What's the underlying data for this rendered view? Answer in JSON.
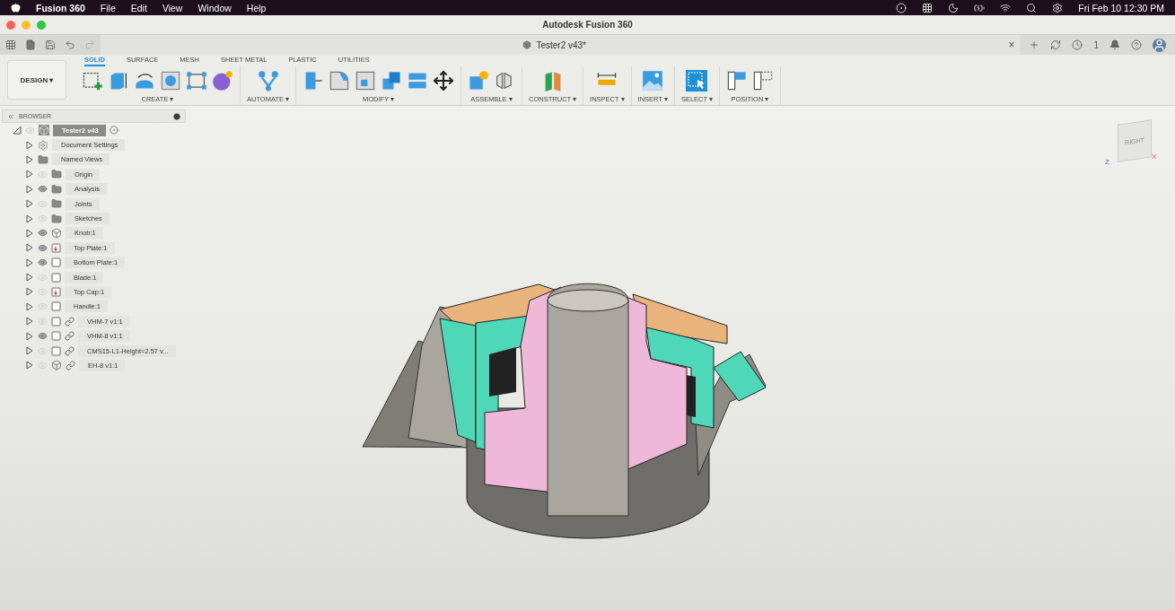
{
  "menubar": {
    "app": "Fusion 360",
    "menus": [
      "File",
      "Edit",
      "View",
      "Window",
      "Help"
    ],
    "clock": "Fri Feb 10  12:30 PM"
  },
  "window": {
    "title": "Autodesk Fusion 360"
  },
  "document_tab": {
    "title": "Tester2 v43*",
    "close": "×"
  },
  "jobs": {
    "count": "1"
  },
  "workspace": {
    "label": "DESIGN ▾"
  },
  "ribbon_tabs": [
    {
      "label": "SOLID",
      "selected": true
    },
    {
      "label": "SURFACE",
      "selected": false
    },
    {
      "label": "MESH",
      "selected": false
    },
    {
      "label": "SHEET METAL",
      "selected": false
    },
    {
      "label": "PLASTIC",
      "selected": false
    },
    {
      "label": "UTILITIES",
      "selected": false
    }
  ],
  "ribbon_groups": [
    {
      "label": "CREATE ▾"
    },
    {
      "label": "AUTOMATE ▾"
    },
    {
      "label": "MODIFY ▾"
    },
    {
      "label": "ASSEMBLE ▾"
    },
    {
      "label": "CONSTRUCT ▾"
    },
    {
      "label": "INSPECT ▾"
    },
    {
      "label": "INSERT ▾"
    },
    {
      "label": "SELECT ▾"
    },
    {
      "label": "POSITION ▾"
    }
  ],
  "browser": {
    "title": "BROWSER",
    "root": {
      "label": "Tester2 v43",
      "visible": false,
      "expanded": true,
      "children": [
        {
          "label": "Document Settings",
          "kind": "gear",
          "linked": false
        },
        {
          "label": "Named Views",
          "kind": "folder",
          "linked": false
        },
        {
          "label": "Origin",
          "kind": "folder",
          "visible": false,
          "linked": false
        },
        {
          "label": "Analysis",
          "kind": "folder",
          "visible": true,
          "linked": false
        },
        {
          "label": "Joints",
          "kind": "folder",
          "visible": false,
          "linked": false
        },
        {
          "label": "Sketches",
          "kind": "folder",
          "visible": false,
          "linked": false
        },
        {
          "label": "Knob:1",
          "kind": "component",
          "visible": true,
          "linked": false
        },
        {
          "label": "Top Plate:1",
          "kind": "activebody",
          "visible": true,
          "linked": false
        },
        {
          "label": "Bottom Plate:1",
          "kind": "body",
          "visible": true,
          "linked": false
        },
        {
          "label": "Blade:1",
          "kind": "body",
          "visible": false,
          "linked": false
        },
        {
          "label": "Top Cap:1",
          "kind": "activebody",
          "visible": false,
          "linked": false
        },
        {
          "label": "Handle:1",
          "kind": "body",
          "visible": false,
          "linked": false
        },
        {
          "label": "VHM-7 v1:1",
          "kind": "body",
          "visible": false,
          "linked": true
        },
        {
          "label": "VHM-8 v1:1",
          "kind": "body",
          "visible": true,
          "linked": true
        },
        {
          "label": "CMS15-L1-Height=2.57 v...",
          "kind": "body",
          "visible": false,
          "linked": true
        },
        {
          "label": "EH-8 v1:1",
          "kind": "component",
          "visible": false,
          "linked": true
        }
      ]
    }
  },
  "viewcube": {
    "face": "RIGHT",
    "axis_z": "Z",
    "axis_x": "X"
  }
}
